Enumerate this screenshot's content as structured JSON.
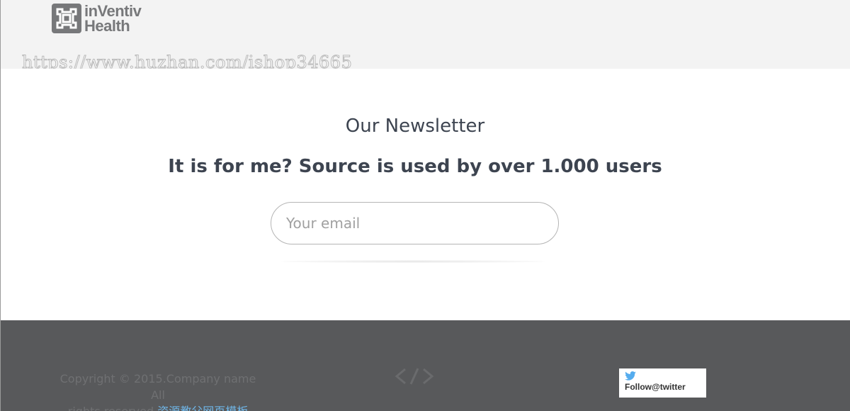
{
  "header": {
    "logo_line1": "inVentiv",
    "logo_line2": "Health",
    "watermark": "https://www.huzhan.com/ishop34665"
  },
  "newsletter": {
    "title": "Our Newsletter",
    "subtitle": "It is for me? Source is used by over 1.000 users",
    "email_placeholder": "Your email",
    "email_value": ""
  },
  "footer": {
    "copyright_line1": "Copyright © 2015.Company name All",
    "copyright_line2": "rights reserved.",
    "copyright_link": "资源教父网页模板",
    "code_icon": "code-brackets-icon",
    "twitter_label": "Follow@twitter",
    "twitter_icon": "twitter-bird-icon"
  },
  "colors": {
    "header_bg": "#f3f3f3",
    "text_dark": "#3d4450",
    "footer_bg": "#58595b",
    "link": "#6fb6e8",
    "logo_gray": "#77787a",
    "twitter_blue": "#55acee"
  }
}
